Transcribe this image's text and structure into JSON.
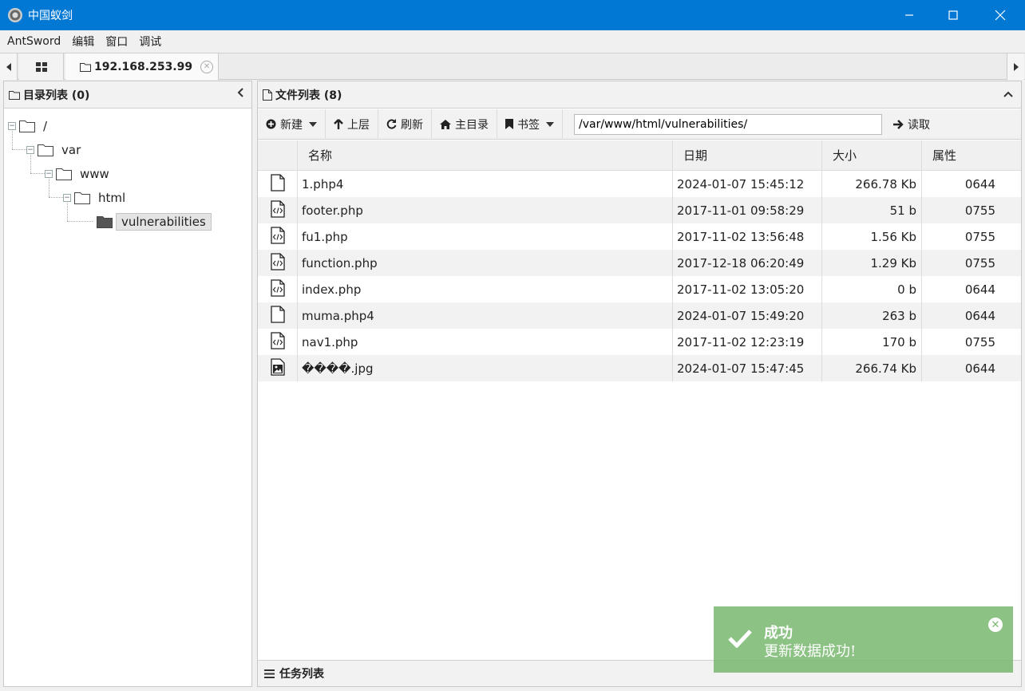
{
  "window": {
    "title": "中国蚁剑"
  },
  "menu": [
    "AntSword",
    "编辑",
    "窗口",
    "调试"
  ],
  "tab": {
    "label": "192.168.253.99"
  },
  "left_panel": {
    "title": "目录列表 (0)",
    "tree": [
      {
        "label": "/"
      },
      {
        "label": "var"
      },
      {
        "label": "www"
      },
      {
        "label": "html"
      },
      {
        "label": "vulnerabilities"
      }
    ]
  },
  "right_panel": {
    "title": "文件列表 (8)",
    "toolbar": {
      "new_label": "新建",
      "up_label": "上层",
      "refresh_label": "刷新",
      "home_label": "主目录",
      "bookmark_label": "书签",
      "path_value": "/var/www/html/vulnerabilities/",
      "read_label": "读取"
    },
    "columns": [
      "名称",
      "日期",
      "大小",
      "属性"
    ],
    "files": [
      {
        "icon": "file-icon",
        "name": "1.php4",
        "date": "2024-01-07 15:45:12",
        "size": "266.78 Kb",
        "attr": "0644"
      },
      {
        "icon": "code-file-icon",
        "name": "footer.php",
        "date": "2017-11-01 09:58:29",
        "size": "51 b",
        "attr": "0755"
      },
      {
        "icon": "code-file-icon",
        "name": "fu1.php",
        "date": "2017-11-02 13:56:48",
        "size": "1.56 Kb",
        "attr": "0755"
      },
      {
        "icon": "code-file-icon",
        "name": "function.php",
        "date": "2017-12-18 06:20:49",
        "size": "1.29 Kb",
        "attr": "0755"
      },
      {
        "icon": "code-file-icon",
        "name": "index.php",
        "date": "2017-11-02 13:05:20",
        "size": "0 b",
        "attr": "0644"
      },
      {
        "icon": "file-icon",
        "name": "muma.php4",
        "date": "2024-01-07 15:49:20",
        "size": "263 b",
        "attr": "0644"
      },
      {
        "icon": "code-file-icon",
        "name": "nav1.php",
        "date": "2017-11-02 12:23:19",
        "size": "170 b",
        "attr": "0755"
      },
      {
        "icon": "image-file-icon",
        "name": "����.jpg",
        "date": "2024-01-07 15:47:45",
        "size": "266.74 Kb",
        "attr": "0644"
      }
    ],
    "task_bar": "任务列表"
  },
  "toast": {
    "title": "成功",
    "message": "更新数据成功!"
  }
}
